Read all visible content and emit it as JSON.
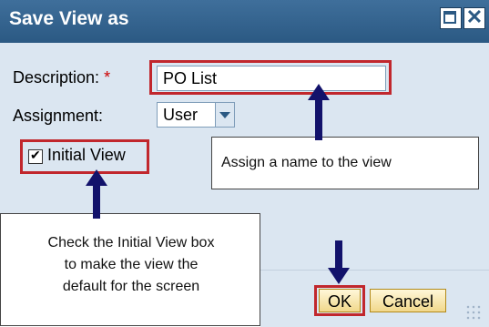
{
  "dialog": {
    "title": "Save View as",
    "maximize_label": "",
    "close_label": "✕"
  },
  "form": {
    "description_label": "Description:",
    "required_mark": "*",
    "description_value": "PO List",
    "assignment_label": "Assignment:",
    "assignment_value": "User",
    "initial_view_label": "Initial View",
    "initial_view_checked": true
  },
  "buttons": {
    "ok_label": "OK",
    "cancel_label": "Cancel"
  },
  "annotations": {
    "name_callout": "Assign a name to the view",
    "initial_view_callout_lines": [
      "Check the Initial View box",
      "to make the view the",
      "default for the screen"
    ]
  },
  "colors": {
    "titlebar": "#2b5983",
    "dialog_bg": "#dbe6f1",
    "highlight": "#c1272d",
    "arrow": "#12126b",
    "button": "#f1d88b"
  }
}
